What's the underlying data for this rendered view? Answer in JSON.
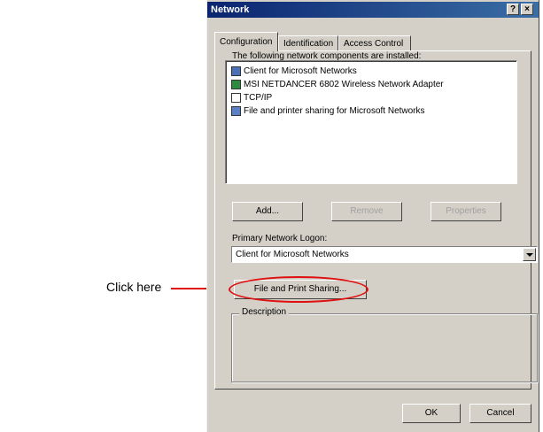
{
  "annotation": {
    "text": "Click here",
    "color": "#e01010"
  },
  "window": {
    "title": "Network",
    "help_button": "?",
    "close_button": "×"
  },
  "tabs": [
    {
      "label": "Configuration",
      "active": true
    },
    {
      "label": "Identification",
      "active": false
    },
    {
      "label": "Access Control",
      "active": false
    }
  ],
  "components": {
    "heading": "The following network components are installed:",
    "items": [
      {
        "label": "Client for Microsoft Networks",
        "icon": "client-icon"
      },
      {
        "label": "MSI NETDANCER 6802 Wireless Network Adapter",
        "icon": "adapter-icon"
      },
      {
        "label": "TCP/IP",
        "icon": "protocol-icon"
      },
      {
        "label": "File and printer sharing for Microsoft Networks",
        "icon": "service-icon"
      }
    ]
  },
  "buttons": {
    "add": "Add...",
    "remove": "Remove",
    "properties": "Properties",
    "file_print_sharing": "File and Print Sharing...",
    "ok": "OK",
    "cancel": "Cancel"
  },
  "logon": {
    "label": "Primary Network Logon:",
    "value": "Client for Microsoft Networks"
  },
  "description": {
    "label": "Description"
  }
}
